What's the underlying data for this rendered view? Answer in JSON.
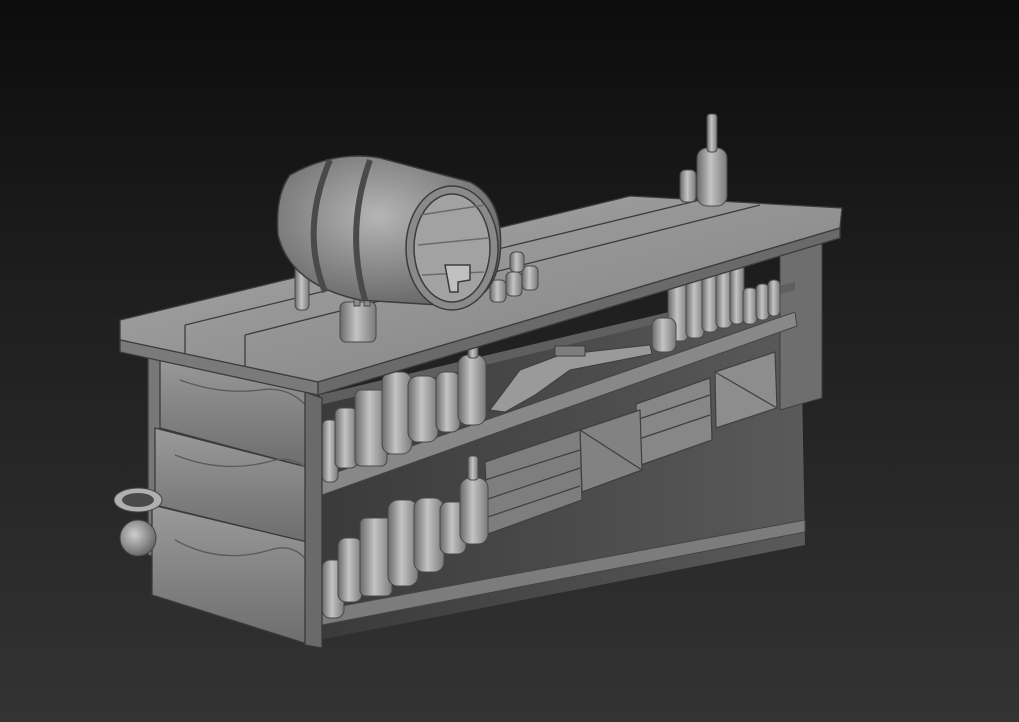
{
  "scene": {
    "subject": "sculpted-bar-counter-model",
    "render_style": "matcap-grey",
    "colors": {
      "background_top": "#0c0c0c",
      "background_bottom": "#333333",
      "clay_light": "#b9b9b9",
      "clay_mid": "#8a8a8a",
      "clay_dark": "#555555",
      "shadow": "#2b2b2b"
    }
  }
}
